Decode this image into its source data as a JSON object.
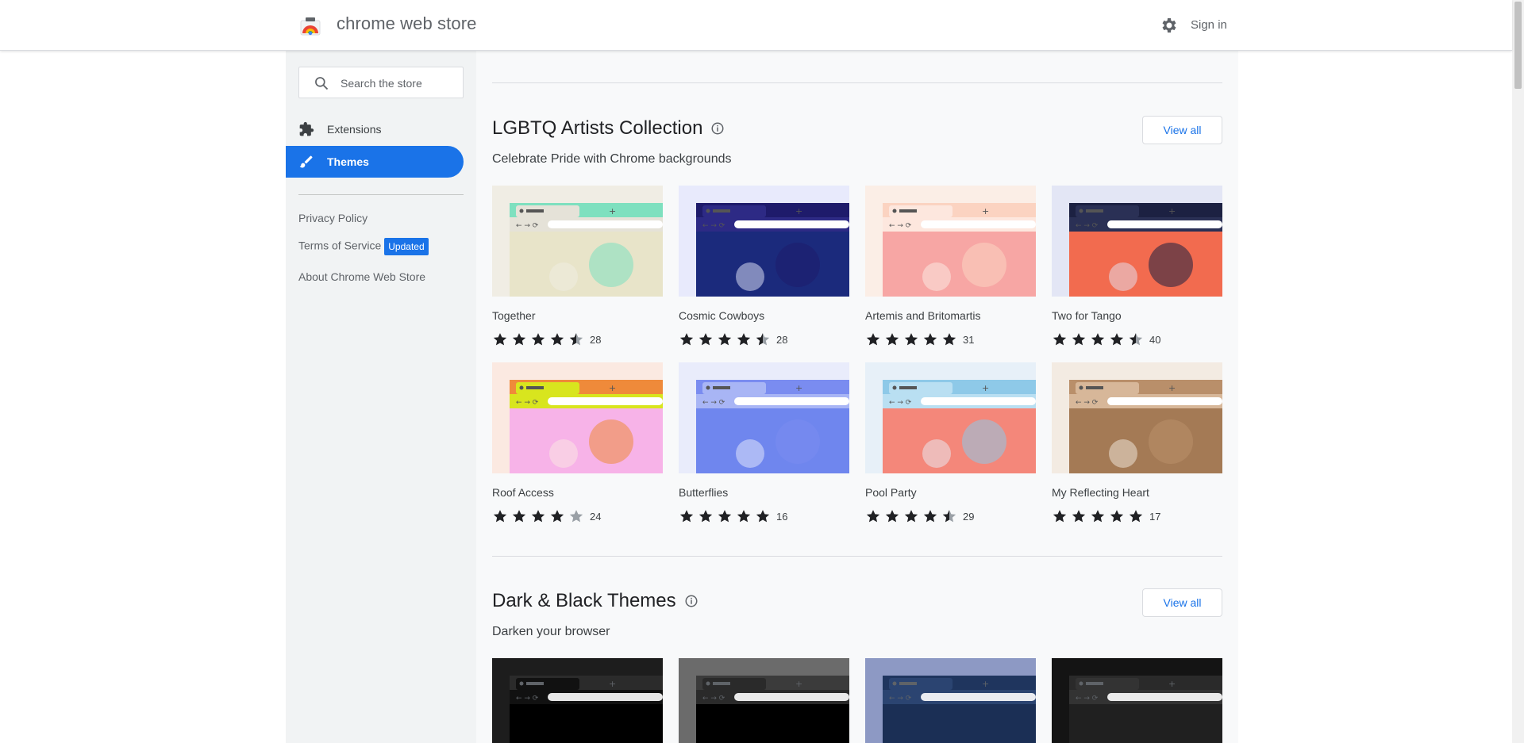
{
  "header": {
    "brand": "chrome web store",
    "sign_in": "Sign in"
  },
  "sidebar": {
    "search_placeholder": "Search the store",
    "nav": [
      {
        "label": "Extensions"
      },
      {
        "label": "Themes"
      }
    ],
    "links": {
      "privacy": "Privacy Policy",
      "terms": "Terms of Service",
      "terms_badge": "Updated",
      "about": "About Chrome Web Store"
    }
  },
  "sections": [
    {
      "title": "LGBTQ Artists Collection",
      "subtitle": "Celebrate Pride with Chrome backgrounds",
      "view_all": "View all",
      "items": [
        {
          "name": "Together",
          "rating": 4.5,
          "count": "28",
          "palette": {
            "bg": "#f0ede4",
            "tab": "#7ee0bf",
            "bar": "#e5e2d8",
            "art": "#e8e4c9"
          }
        },
        {
          "name": "Cosmic Cowboys",
          "rating": 4.5,
          "count": "28",
          "palette": {
            "bg": "#e8eafc",
            "tab": "#1e1b6b",
            "bar": "#2d2a85",
            "art": "#1b2a7c"
          }
        },
        {
          "name": "Artemis and Britomartis",
          "rating": 5,
          "count": "31",
          "palette": {
            "bg": "#fbeee6",
            "tab": "#fbd3c1",
            "bar": "#fde7de",
            "art": "#f7a6a4"
          }
        },
        {
          "name": "Two for Tango",
          "rating": 4.5,
          "count": "40",
          "palette": {
            "bg": "#e3e6f5",
            "tab": "#1c2142",
            "bar": "#2a3055",
            "art": "#f26b4f"
          }
        },
        {
          "name": "Roof Access",
          "rating": 4,
          "count": "24",
          "palette": {
            "bg": "#fbe9e1",
            "tab": "#ef8a3a",
            "bar": "#d8e51e",
            "art": "#f7b3e8"
          }
        },
        {
          "name": "Butterflies",
          "rating": 5,
          "count": "16",
          "palette": {
            "bg": "#e9ecfb",
            "tab": "#7a8cf0",
            "bar": "#a8b5f5",
            "art": "#6f86ee"
          }
        },
        {
          "name": "Pool Party",
          "rating": 4.5,
          "count": "29",
          "palette": {
            "bg": "#e7f0f8",
            "tab": "#8ec9e8",
            "bar": "#b9dff2",
            "art": "#f4877a"
          }
        },
        {
          "name": "My Reflecting Heart",
          "rating": 5,
          "count": "17",
          "palette": {
            "bg": "#f3ebe2",
            "tab": "#b98f6a",
            "bar": "#d7b799",
            "art": "#a47a55"
          }
        }
      ]
    },
    {
      "title": "Dark & Black Themes",
      "subtitle": "Darken your browser",
      "view_all": "View all",
      "items": [
        {
          "palette": {
            "bg": "#1d1d1d",
            "tab": "#2b2b2b",
            "bar": "#111111",
            "art": "#000000"
          }
        },
        {
          "palette": {
            "bg": "#6b6b6b",
            "tab": "#3b3b3b",
            "bar": "#2a2a2a",
            "art": "#000000"
          }
        },
        {
          "palette": {
            "bg": "#8d99c4",
            "tab": "#1f355e",
            "bar": "#2b4471",
            "art": "#1b2f55"
          }
        },
        {
          "palette": {
            "bg": "#141414",
            "tab": "#2a2a2a",
            "bar": "#333333",
            "art": "#202020"
          }
        }
      ]
    }
  ],
  "colors": {
    "accent": "#1a73e8",
    "star": "#202124",
    "star_empty": "#9aa0a6"
  }
}
